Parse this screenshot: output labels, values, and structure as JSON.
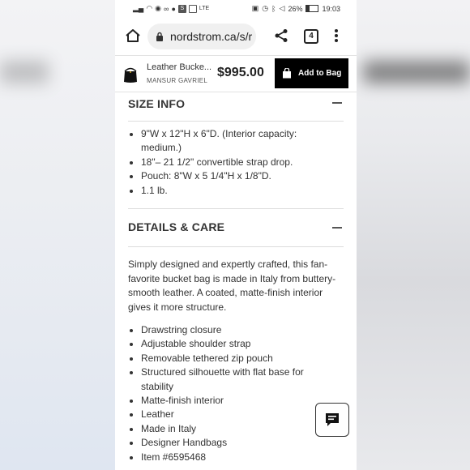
{
  "status_bar": {
    "left_badge": "S",
    "left_text": "LTE",
    "battery": "26%",
    "time": "19:03"
  },
  "browser": {
    "url": "nordstrom.ca/s/r",
    "tab_count": "4"
  },
  "product_bar": {
    "name": "Leather Bucke...",
    "brand": "MANSUR GAVRIEL",
    "price": "$995.00",
    "add_to_bag": "Add to Bag"
  },
  "size_info": {
    "title": "SIZE INFO",
    "items": [
      "9\"W x 12\"H x 6\"D. (Interior capacity: medium.)",
      "18\"– 21 1/2\" convertible strap drop.",
      "Pouch: 8\"W x 5 1/4\"H x 1/8\"D.",
      "1.1 lb."
    ]
  },
  "details": {
    "title": "DETAILS & CARE",
    "description": "Simply designed and expertly crafted, this fan-favorite bucket bag is made in Italy from buttery-smooth leather. A coated, matte-finish interior gives it more structure.",
    "items": [
      "Drawstring closure",
      "Adjustable shoulder strap",
      "Removable tethered zip pouch",
      "Structured silhouette with flat base for stability",
      "Matte-finish interior",
      "Leather",
      "Made in Italy",
      "Designer Handbags",
      "Item #6595468"
    ]
  }
}
